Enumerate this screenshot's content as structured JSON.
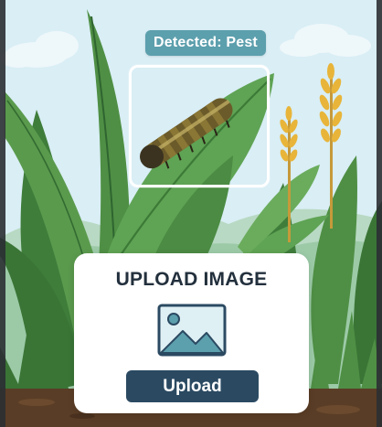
{
  "detection": {
    "badge_label": "Detected: Pest"
  },
  "upload_card": {
    "title": "UPLOAD IMAGE",
    "button_label": "Upload",
    "icon": "image-placeholder-icon"
  },
  "colors": {
    "badge_bg": "#5c9fad",
    "button_bg": "#2b4a62",
    "title_text": "#23303d",
    "sky": "#d9eef5",
    "leaf_green": "#4f8f45",
    "grain_yellow": "#e8b53a"
  }
}
